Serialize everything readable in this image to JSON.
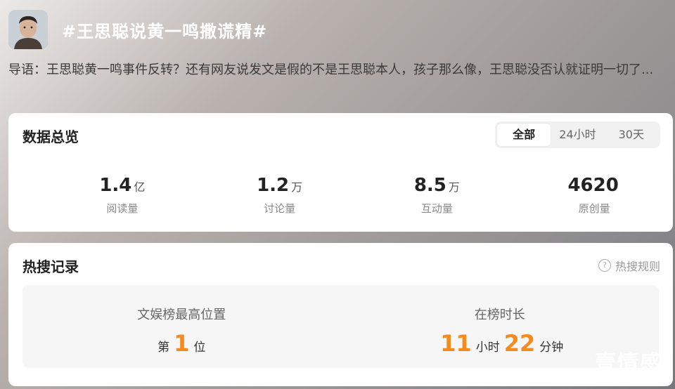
{
  "header": {
    "topic_title": "#王思聪说黄一鸣撒谎精#",
    "intro": "导语：王思聪黄一鸣事件反转？还有网友说发文是假的不是王思聪本人，孩子那么像，王思聪没否认就证明一切了..."
  },
  "overview": {
    "title": "数据总览",
    "tabs": [
      {
        "label": "全部",
        "active": true
      },
      {
        "label": "24小时",
        "active": false
      },
      {
        "label": "30天",
        "active": false
      }
    ],
    "stats": [
      {
        "value": "1.4",
        "unit": "亿",
        "label": "阅读量"
      },
      {
        "value": "1.2",
        "unit": "万",
        "label": "讨论量"
      },
      {
        "value": "8.5",
        "unit": "万",
        "label": "互动量"
      },
      {
        "value": "4620",
        "unit": "",
        "label": "原创量"
      }
    ]
  },
  "hot_search": {
    "title": "热搜记录",
    "rules_label": "热搜规则",
    "rules_icon": "question-circle-icon",
    "highest_label": "文娱榜最高位置",
    "rank_prefix": "第",
    "rank_value": "1",
    "rank_suffix": "位",
    "duration_label": "在榜时长",
    "hours_value": "11",
    "hours_unit": "小时",
    "minutes_value": "22",
    "minutes_unit": "分钟"
  },
  "watermark": "壹情感",
  "colors": {
    "accent": "#f58a1f",
    "card_bg": "#ffffff",
    "record_bg": "#f6f6f6"
  }
}
